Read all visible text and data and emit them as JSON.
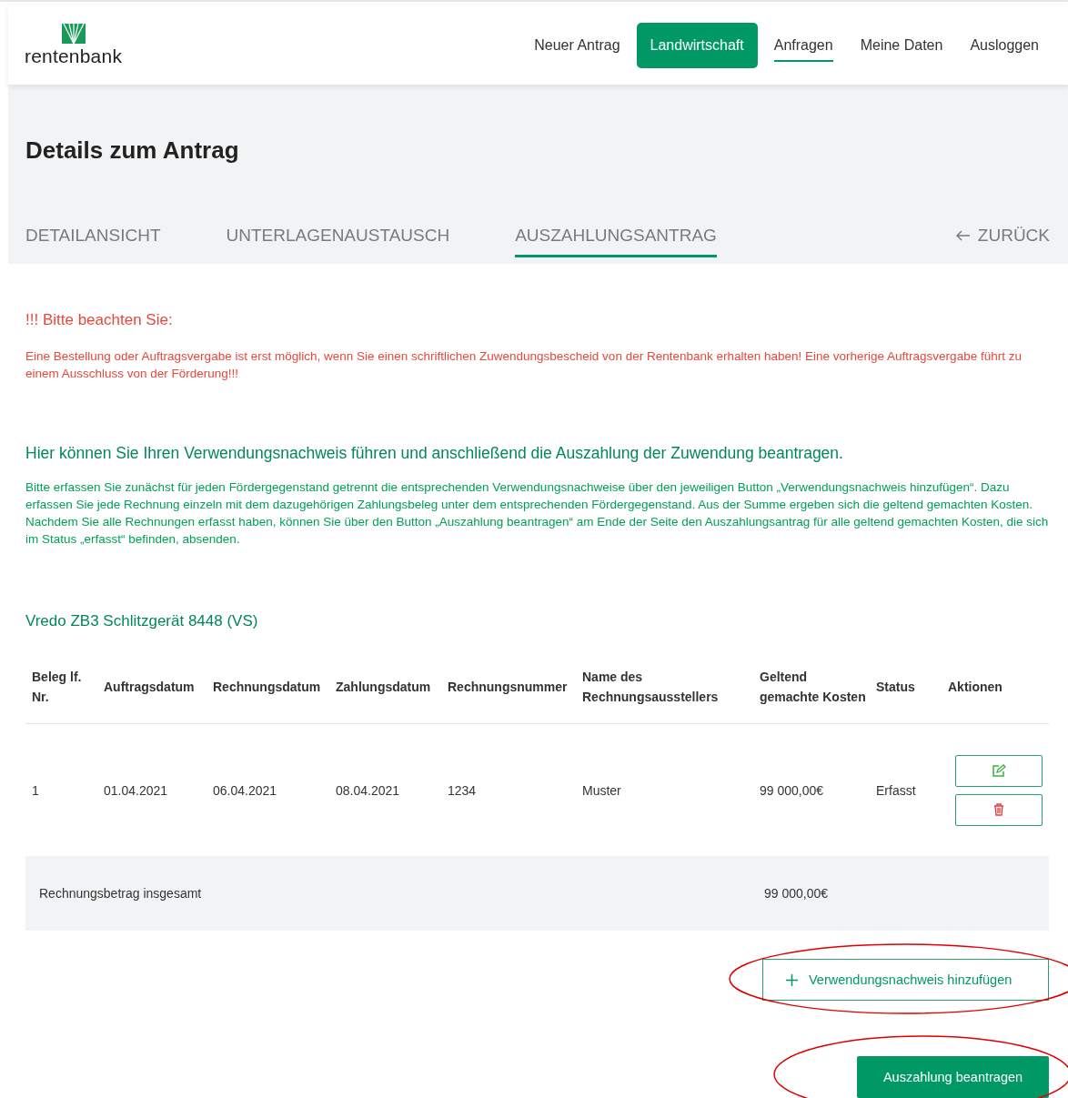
{
  "header": {
    "logo": "rentenbank",
    "nav": [
      {
        "label": "Neuer Antrag",
        "kind": "link",
        "selected": false
      },
      {
        "label": "Landwirtschaft",
        "kind": "button",
        "selected": false
      },
      {
        "label": "Anfragen",
        "kind": "link",
        "selected": true
      },
      {
        "label": "Meine Daten",
        "kind": "link",
        "selected": false
      },
      {
        "label": "Ausloggen",
        "kind": "link",
        "selected": false
      }
    ]
  },
  "page_title": "Details zum Antrag",
  "tabs": [
    {
      "label": "DETAILANSICHT",
      "selected": false
    },
    {
      "label": "UNTERLAGENAUSTAUSCH",
      "selected": false
    },
    {
      "label": "AUSZAHLUNGSANTRAG",
      "selected": true
    }
  ],
  "back_link": "ZURÜCK",
  "notice": {
    "title": "!!! Bitte beachten Sie:",
    "text": "Eine Bestellung oder Auftragsvergabe ist erst möglich, wenn Sie einen schriftlichen Zuwendungsbescheid von der Rentenbank erhalten haben! Eine vorherige Auftragsvergabe führt zu einem Ausschluss von der Förderung!!!"
  },
  "intro": {
    "heading": "Hier können Sie Ihren Verwendungsnachweis führen und anschließend die Auszahlung der Zuwendung beantragen.",
    "text": "Bitte erfassen Sie zunächst für jeden Fördergegenstand getrennt die entsprechenden Verwendungsnachweise über den jeweiligen Button „Verwendungsnachweis hinzufügen“. Dazu erfassen Sie jede Rechnung einzeln mit dem dazugehörigen Zahlungsbeleg unter dem entsprechenden Fördergegenstand. Aus der Summe ergeben sich die geltend gemachten Kosten. Nachdem Sie alle Rechnungen erfasst haben, können Sie über den Button „Auszahlung beantragen“ am Ende der Seite den Auszahlungsantrag für alle geltend gemachten Kosten, die sich im Status „erfasst“ befinden, absenden."
  },
  "item_title": "Vredo ZB3 Schlitzgerät 8448 (VS)",
  "table": {
    "columns": [
      "Beleg lf. Nr.",
      "Auftragsdatum",
      "Rechnungsdatum",
      "Zahlungsdatum",
      "Rechnungsnummer",
      "Name des Rechnungsausstellers",
      "Geltend gemachte Kosten",
      "Status",
      "Aktionen"
    ],
    "rows": [
      {
        "cells": [
          "1",
          "01.04.2021",
          "06.04.2021",
          "08.04.2021",
          "1234",
          "Muster",
          "99 000,00€",
          "Erfasst"
        ]
      }
    ],
    "total": {
      "label": "Rechnungsbetrag insgesamt",
      "value": "99 000,00€"
    }
  },
  "buttons": [
    {
      "label": "Verwendungsnachweis hinzufügen",
      "kind": "outline",
      "highlighted": true
    },
    {
      "label": "Auszahlung beantragen",
      "kind": "solid",
      "highlighted": true
    }
  ]
}
